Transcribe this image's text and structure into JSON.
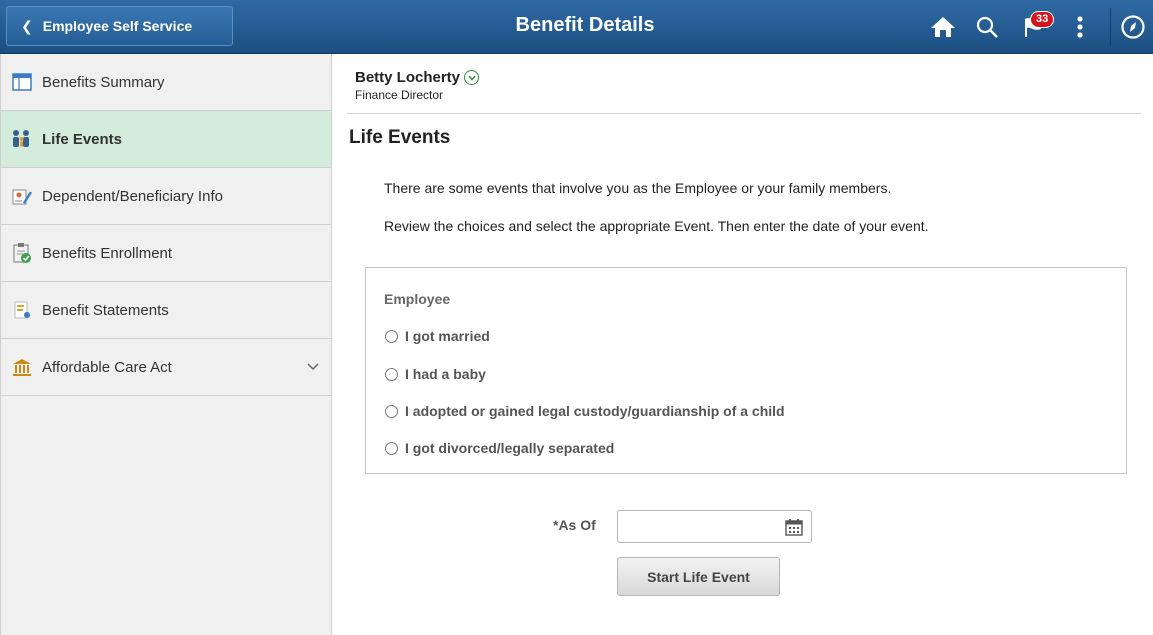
{
  "header": {
    "back_label": "Employee Self Service",
    "title": "Benefit Details",
    "notification_count": "33",
    "icons": [
      "home-icon",
      "search-icon",
      "notifications-flag-icon",
      "actions-menu-icon",
      "navbar-compass-icon"
    ]
  },
  "sidebar": {
    "items": [
      {
        "label": "Benefits Summary",
        "icon": "benefits-summary-icon"
      },
      {
        "label": "Life Events",
        "icon": "life-events-icon",
        "active": true
      },
      {
        "label": "Dependent/Beneficiary Info",
        "icon": "dependent-info-icon"
      },
      {
        "label": "Benefits Enrollment",
        "icon": "benefits-enrollment-icon"
      },
      {
        "label": "Benefit Statements",
        "icon": "benefit-statements-icon"
      },
      {
        "label": "Affordable Care Act",
        "icon": "affordable-care-act-icon",
        "expandable": true
      }
    ]
  },
  "person": {
    "name": "Betty Locherty",
    "title": "Finance Director"
  },
  "main": {
    "section_title": "Life Events",
    "intro_line1": "There are some events that involve you as the Employee or your family members.",
    "intro_line2": "Review the choices and select the appropriate Event. Then enter the date of your event.",
    "group_label": "Employee",
    "options": [
      "I got married",
      "I had a baby",
      "I adopted or gained legal custody/guardianship of a child",
      "I got divorced/legally separated"
    ],
    "as_of_label": "*As Of",
    "as_of_value": "",
    "start_button": "Start Life Event"
  },
  "colors": {
    "header_bg": "#1c4f82",
    "active_nav_bg": "#d3ecdb",
    "badge_red": "#d7141e"
  }
}
